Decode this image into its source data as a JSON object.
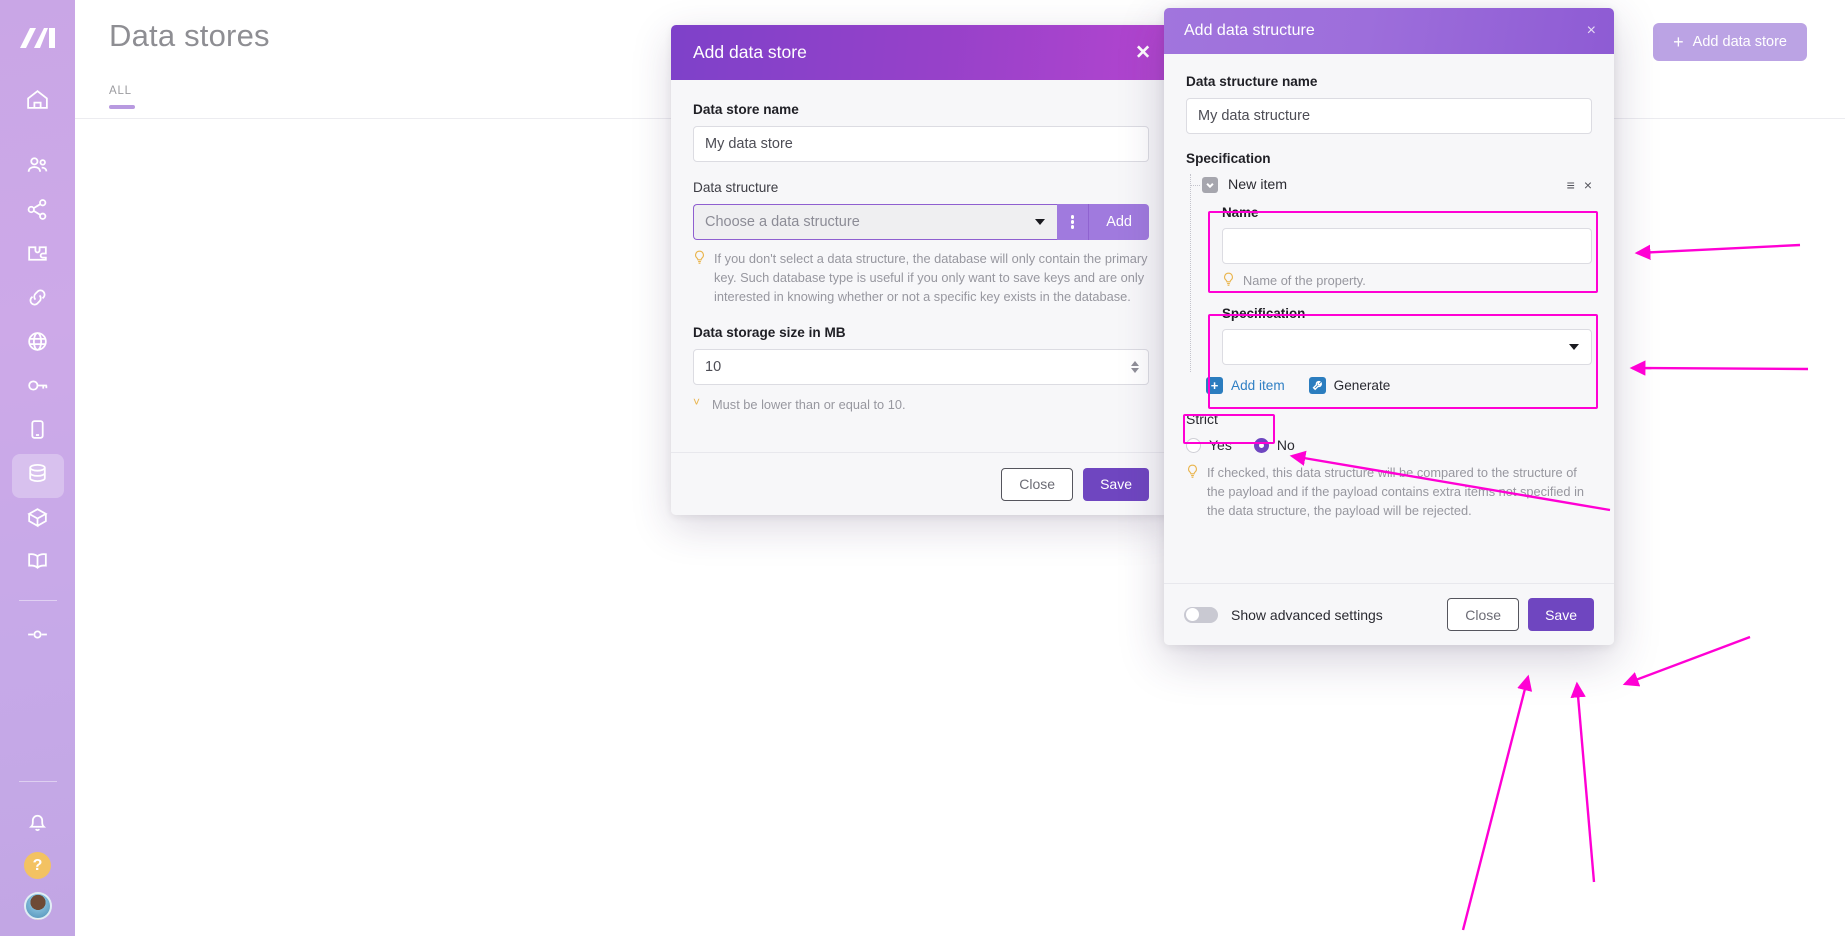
{
  "sidebar": {
    "logo": "make-logo",
    "items": [
      {
        "name": "home-icon",
        "label": "Home"
      },
      {
        "name": "team-icon",
        "label": "Team"
      },
      {
        "name": "scenarios-icon",
        "label": "Scenarios"
      },
      {
        "name": "templates-icon",
        "label": "Templates"
      },
      {
        "name": "connections-icon",
        "label": "Connections"
      },
      {
        "name": "webhooks-icon",
        "label": "Webhooks"
      },
      {
        "name": "keys-icon",
        "label": "Keys"
      },
      {
        "name": "devices-icon",
        "label": "Devices"
      },
      {
        "name": "data-stores-icon",
        "label": "Data stores"
      },
      {
        "name": "data-structures-icon",
        "label": "Data structures"
      },
      {
        "name": "docs-icon",
        "label": "Docs"
      },
      {
        "name": "more-icon",
        "label": "More"
      }
    ],
    "bottom": [
      {
        "name": "notifications-icon",
        "label": "Notifications"
      },
      {
        "name": "help-icon",
        "label": "?"
      },
      {
        "name": "avatar",
        "label": "Profile"
      }
    ]
  },
  "page": {
    "title": "Data stores",
    "tab": "ALL",
    "add_button": "Add data store",
    "add_button_plus": "+"
  },
  "modal_data_store": {
    "title": "Add data store",
    "close_icon": "✕",
    "name_label": "Data store name",
    "name_value": "My data store",
    "structure_label": "Data structure",
    "structure_placeholder": "Choose a data structure",
    "kebab_icon": "kebab-menu",
    "add_label": "Add",
    "structure_hint": "If you don't select a data structure, the database will only contain the primary key. Such database type is useful if you only want to save keys and are only interested in knowing whether or not a specific key exists in the database.",
    "size_label": "Data storage size in MB",
    "size_value": "10",
    "size_hint": "Must be lower than or equal to 10.",
    "close_label": "Close",
    "save_label": "Save"
  },
  "modal_data_structure": {
    "title": "Add data structure",
    "close_icon": "×",
    "name_label": "Data structure name",
    "name_value": "My data structure",
    "spec_label": "Specification",
    "item": {
      "label": "New item",
      "drag_icon": "≡",
      "remove_icon": "×",
      "name_label": "Name",
      "name_value": "",
      "name_hint": "Name of the property.",
      "spec_label": "Specification",
      "spec_value": ""
    },
    "add_item_label": "Add item",
    "add_item_icon": "+",
    "generate_label": "Generate",
    "generate_icon": "wrench-icon",
    "strict_label": "Strict",
    "strict_yes": "Yes",
    "strict_no": "No",
    "strict_selected": "No",
    "strict_hint": "If checked, this data structure will be compared to the structure of the payload and if the payload contains extra items not specified in the data structure, the payload will be rejected.",
    "advanced_toggle_label": "Show advanced settings",
    "close_label": "Close",
    "save_label": "Save"
  },
  "annotations": {
    "highlight_color": "#ff00d4",
    "highlights": [
      "name-field",
      "specification-field",
      "add-item-button",
      "save-button"
    ],
    "arrow_count": 6
  }
}
